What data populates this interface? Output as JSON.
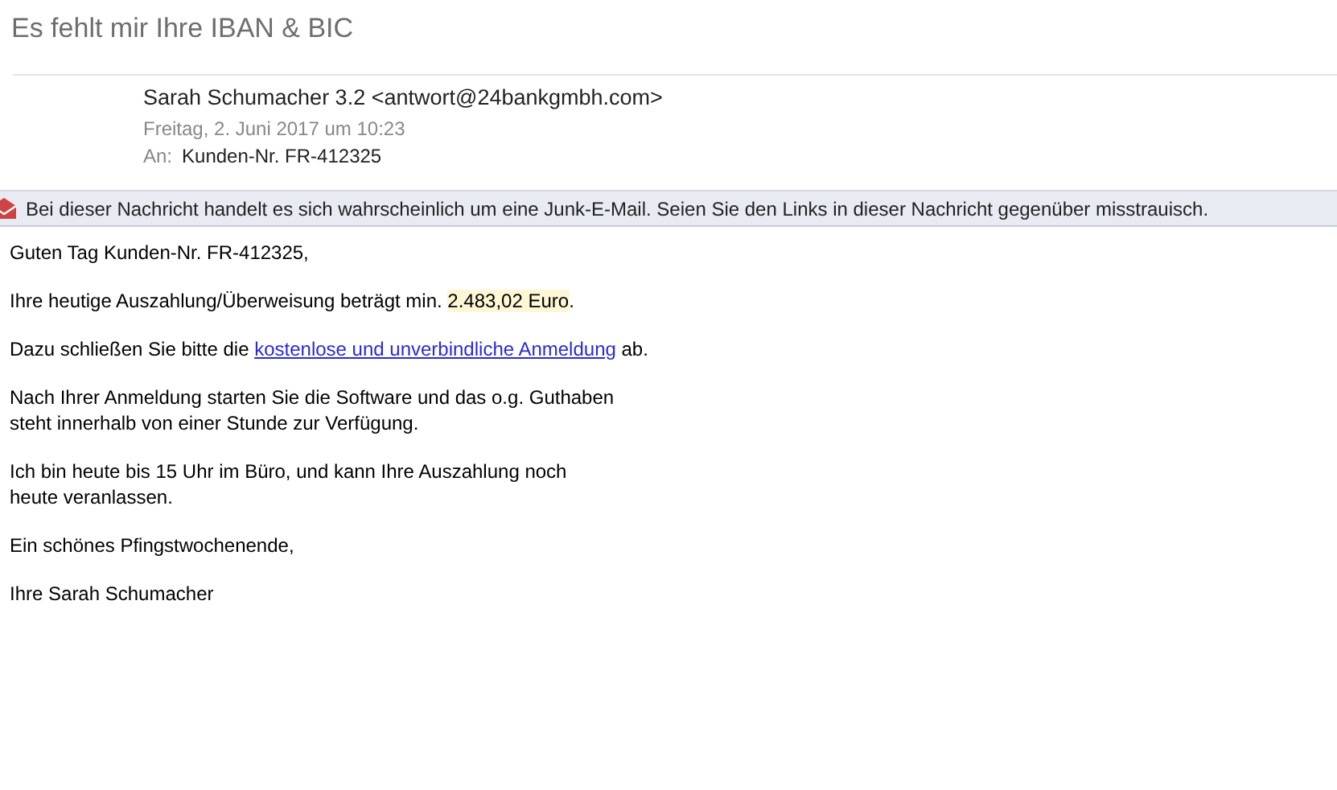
{
  "subject": "Es fehlt mir Ihre IBAN & BIC",
  "header": {
    "sender": "Sarah Schumacher 3.2 <antwort@24bankgmbh.com>",
    "date": "Freitag, 2. Juni 2017 um 10:23",
    "to_label": "An:",
    "to": "Kunden-Nr. FR-412325"
  },
  "junk_banner": "Bei dieser Nachricht handelt es sich wahrscheinlich um eine Junk-E-Mail. Seien Sie den Links in dieser Nachricht gegenüber misstrauisch.",
  "body": [
    {
      "parts": [
        {
          "kind": "text",
          "text": "Guten Tag Kunden-Nr. FR-412325,"
        }
      ]
    },
    {
      "parts": [
        {
          "kind": "text",
          "text": "Ihre heutige Auszahlung/Überweisung beträgt min. "
        },
        {
          "kind": "highlight",
          "text": "2.483,02 Euro"
        },
        {
          "kind": "text",
          "text": "."
        }
      ]
    },
    {
      "parts": [
        {
          "kind": "text",
          "text": "Dazu schließen Sie bitte die "
        },
        {
          "kind": "link",
          "text": "kostenlose und unverbindliche Anmeldung"
        },
        {
          "kind": "text",
          "text": " ab."
        }
      ]
    },
    {
      "lines": [
        "Nach Ihrer Anmeldung starten Sie die Software und das o.g. Guthaben",
        "steht innerhalb von einer Stunde zur Verfügung."
      ]
    },
    {
      "lines": [
        "Ich bin heute bis 15 Uhr im Büro, und kann Ihre Auszahlung noch",
        "heute veranlassen."
      ]
    },
    {
      "parts": [
        {
          "kind": "text",
          "text": "Ein schönes Pfingstwochenende,"
        }
      ]
    },
    {
      "parts": [
        {
          "kind": "text",
          "text": "Ihre Sarah Schumacher"
        }
      ]
    }
  ]
}
